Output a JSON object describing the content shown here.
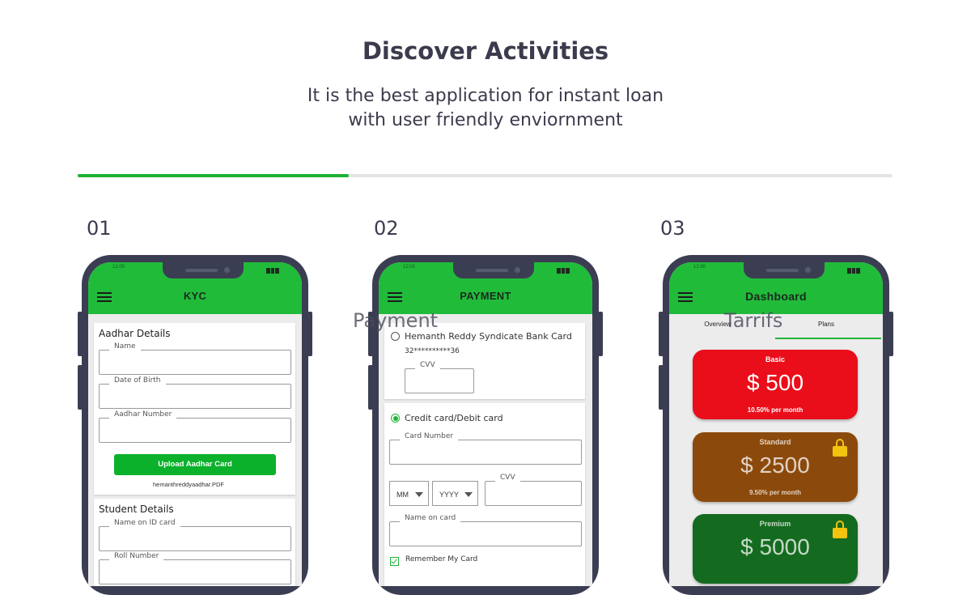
{
  "header": {
    "title": "Discover Activities",
    "subtitle_line1": "It is the best application for instant loan",
    "subtitle_line2": "with user friendly enviornment"
  },
  "progress": {
    "fraction": 0.333
  },
  "colors": {
    "accent": "#1db233",
    "appbar": "#21bb3a",
    "phone_frame": "#3b3e52",
    "basic": "#ea0e1a",
    "standard": "#8b4a0c",
    "premium": "#146b1f",
    "lock": "#f2c40e"
  },
  "steps": [
    {
      "number": "01"
    },
    {
      "number": "02",
      "ghost_label": "Payment"
    },
    {
      "number": "03",
      "ghost_label": "Tarrifs"
    }
  ],
  "phone1": {
    "clock": "12:00",
    "title": "KYC",
    "aadhar": {
      "section_title": "Aadhar Details",
      "name_label": "Name",
      "dob_label": "Date of Birth",
      "number_label": "Aadhar Number",
      "upload_button": "Upload Aadhar Card",
      "file_name": "hemanthreddyaadhar.PDF"
    },
    "student": {
      "section_title": "Student Details",
      "id_name_label": "Name on ID card",
      "roll_label": "Roll Number"
    }
  },
  "phone2": {
    "clock": "12:00",
    "title": "PAYMENT",
    "saved_card": {
      "name": "Hemanth Reddy Syndicate Bank Card",
      "number": "32**********36",
      "cvv_label": "CVV"
    },
    "new_card": {
      "option_label": "Credit card/Debit card",
      "card_number_label": "Card Number",
      "month_value": "MM",
      "year_value": "YYYY",
      "cvv_label": "CVV",
      "name_label": "Name on card",
      "remember_label": "Remember My Card"
    }
  },
  "phone3": {
    "clock": "12:00",
    "title": "Dashboard",
    "tabs": [
      "Overview",
      "Plans"
    ],
    "plans": [
      {
        "name": "Basic",
        "price": "$ 500",
        "per": "10.50% per month",
        "locked": false
      },
      {
        "name": "Standard",
        "price": "$ 2500",
        "per": "9.50% per month",
        "locked": true
      },
      {
        "name": "Premium",
        "price": "$ 5000",
        "per": "",
        "locked": true
      }
    ]
  }
}
